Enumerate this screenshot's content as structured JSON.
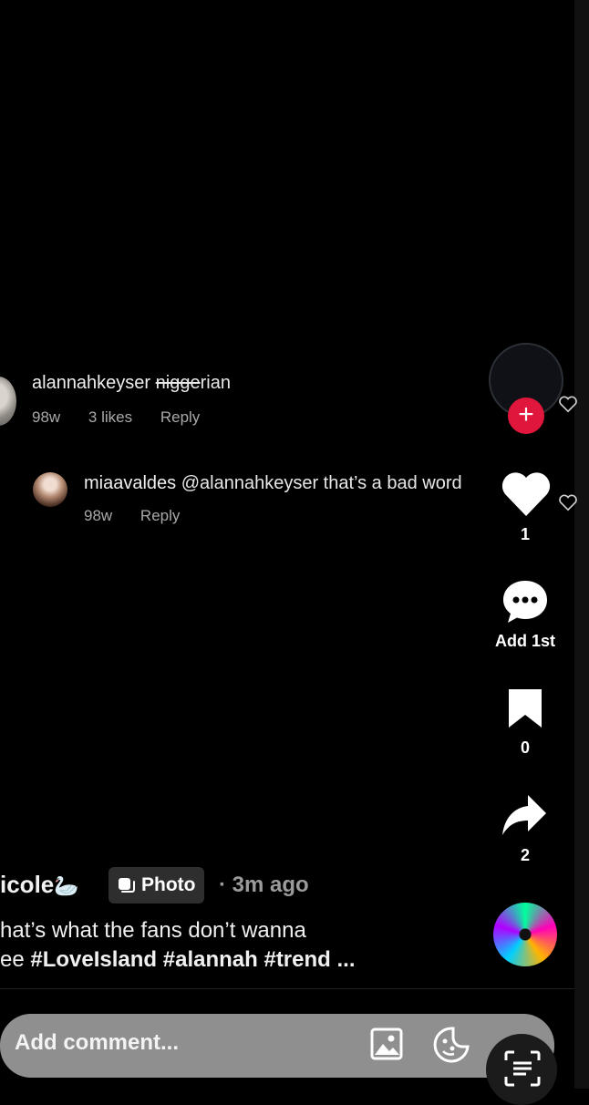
{
  "comments": [
    {
      "username": "alannahkeyser",
      "text_struck": "nigge",
      "text_rest": "rian",
      "age": "98w",
      "likes": "3 likes",
      "reply_label": "Reply"
    },
    {
      "username": "miaavaldes",
      "text": "@alannahkeyser that’s a bad word",
      "age": "98w",
      "reply_label": "Reply"
    }
  ],
  "rail": {
    "like_count": "1",
    "comment_label": "Add 1st",
    "save_count": "0",
    "share_count": "2"
  },
  "post": {
    "username": "icole",
    "badge_label": "Photo",
    "time": "· 3m ago",
    "caption_line1": "hat’s what the fans don’t wanna",
    "caption_line2_prefix": "ee ",
    "hashtags": "#LoveIsland #alannah #trend",
    "ellipsis": " ..."
  },
  "comment_bar": {
    "placeholder": "Add comment..."
  },
  "colors": {
    "background": "#000000",
    "follow_plus": "#e1163c",
    "comment_bar": "#8f8f8f"
  }
}
